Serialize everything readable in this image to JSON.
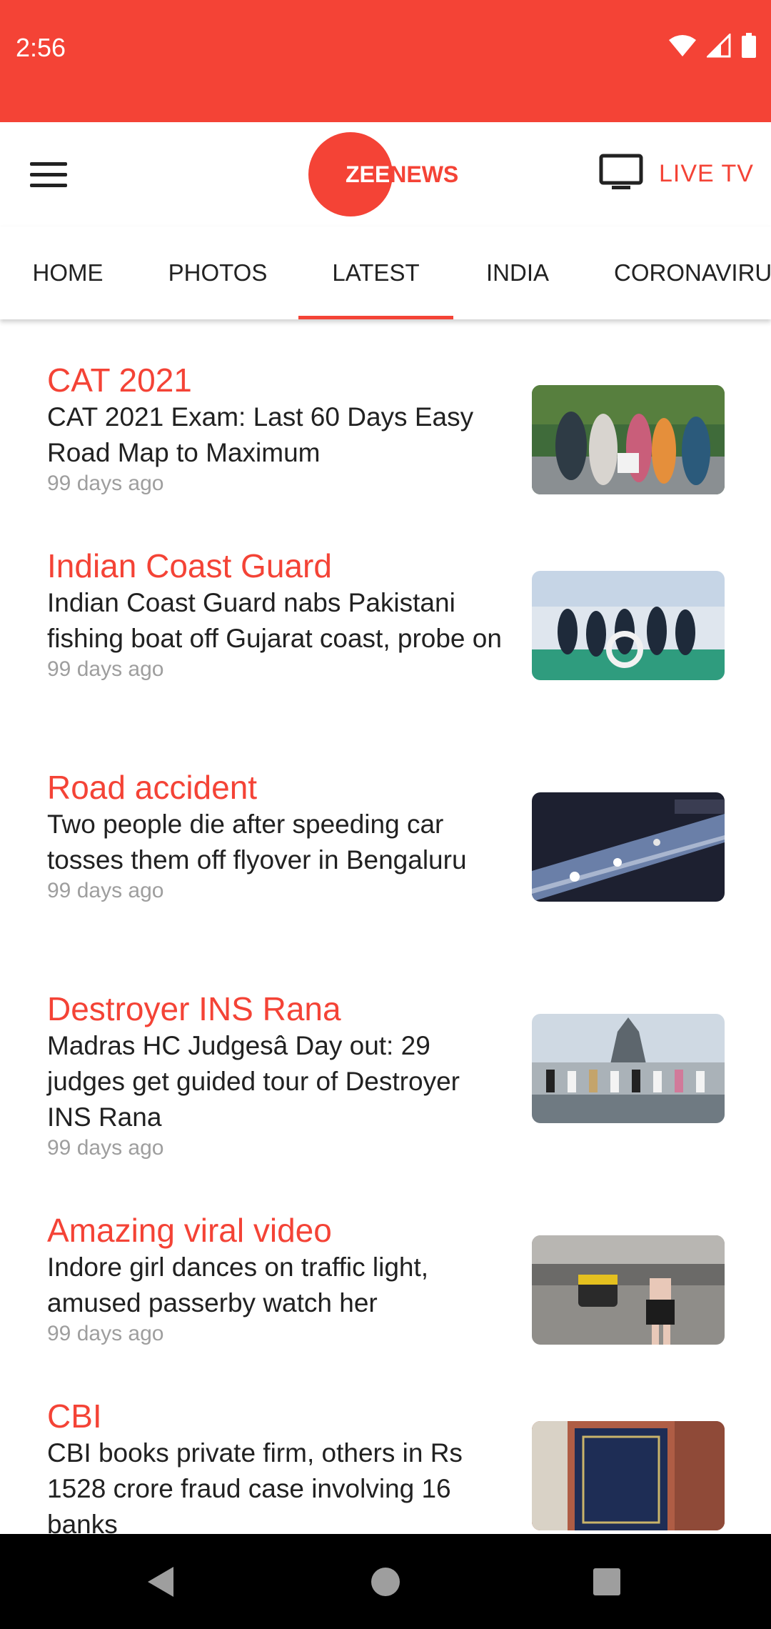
{
  "status_bar": {
    "time": "2:56",
    "icons": [
      "wifi-icon",
      "cellular-signal-icon",
      "battery-icon"
    ]
  },
  "toolbar": {
    "menu_icon": "hamburger-menu-icon",
    "logo": {
      "part1": "ZEE",
      "part2": "NEWS"
    },
    "live_tv_icon": "tv-icon",
    "live_tv_label": "LIVE TV"
  },
  "tabs": [
    {
      "label": "HOME"
    },
    {
      "label": "PHOTOS"
    },
    {
      "label": "LATEST",
      "selected": true
    },
    {
      "label": "INDIA"
    },
    {
      "label": "CORONAVIRU"
    }
  ],
  "articles": [
    {
      "category": "CAT 2021",
      "headline": "CAT 2021 Exam: Last 60 Days Easy Road Map to Maximum",
      "time": "99 days ago"
    },
    {
      "category": "Indian Coast Guard",
      "headline": "Indian Coast Guard nabs Pakistani fishing boat off Gujarat coast, probe on",
      "time": "99 days ago"
    },
    {
      "category": "Road accident",
      "headline": "Two people die after speeding car tosses them off flyover in Bengaluru",
      "time": "99 days ago"
    },
    {
      "category": "Destroyer INS Rana",
      "headline": "Madras HC Judgesâ Day out: 29 judges get guided tour of Destroyer INS Rana",
      "time": "99 days ago"
    },
    {
      "category": "Amazing viral video",
      "headline": "Indore girl dances on traffic light, amused passerby watch her",
      "time": "99 days ago"
    },
    {
      "category": "CBI",
      "headline": "CBI books private firm, others in Rs 1528 crore fraud case involving 16 banks",
      "time": ""
    }
  ],
  "nav_bar": {
    "icons": [
      "back-icon",
      "home-icon",
      "recents-icon"
    ]
  },
  "colors": {
    "accent": "#f44336",
    "text": "#212121",
    "secondary_text": "#9e9e9e"
  }
}
